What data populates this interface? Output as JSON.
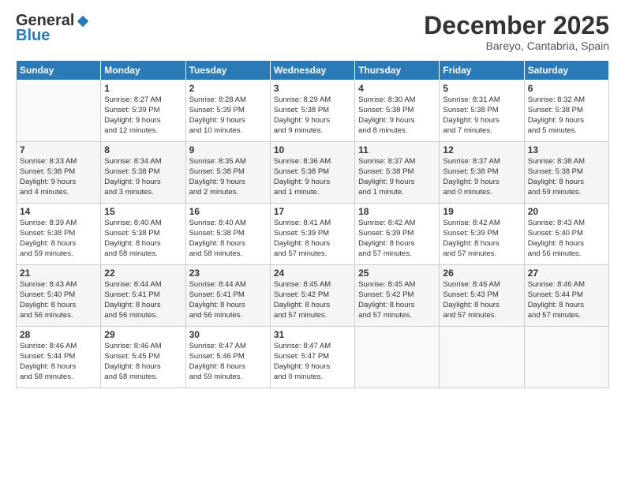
{
  "header": {
    "logo_general": "General",
    "logo_blue": "Blue",
    "month": "December 2025",
    "location": "Bareyo, Cantabria, Spain"
  },
  "weekdays": [
    "Sunday",
    "Monday",
    "Tuesday",
    "Wednesday",
    "Thursday",
    "Friday",
    "Saturday"
  ],
  "weeks": [
    [
      {
        "day": "",
        "info": ""
      },
      {
        "day": "1",
        "info": "Sunrise: 8:27 AM\nSunset: 5:39 PM\nDaylight: 9 hours\nand 12 minutes."
      },
      {
        "day": "2",
        "info": "Sunrise: 8:28 AM\nSunset: 5:39 PM\nDaylight: 9 hours\nand 10 minutes."
      },
      {
        "day": "3",
        "info": "Sunrise: 8:29 AM\nSunset: 5:38 PM\nDaylight: 9 hours\nand 9 minutes."
      },
      {
        "day": "4",
        "info": "Sunrise: 8:30 AM\nSunset: 5:38 PM\nDaylight: 9 hours\nand 8 minutes."
      },
      {
        "day": "5",
        "info": "Sunrise: 8:31 AM\nSunset: 5:38 PM\nDaylight: 9 hours\nand 7 minutes."
      },
      {
        "day": "6",
        "info": "Sunrise: 8:32 AM\nSunset: 5:38 PM\nDaylight: 9 hours\nand 5 minutes."
      }
    ],
    [
      {
        "day": "7",
        "info": "Sunrise: 8:33 AM\nSunset: 5:38 PM\nDaylight: 9 hours\nand 4 minutes."
      },
      {
        "day": "8",
        "info": "Sunrise: 8:34 AM\nSunset: 5:38 PM\nDaylight: 9 hours\nand 3 minutes."
      },
      {
        "day": "9",
        "info": "Sunrise: 8:35 AM\nSunset: 5:38 PM\nDaylight: 9 hours\nand 2 minutes."
      },
      {
        "day": "10",
        "info": "Sunrise: 8:36 AM\nSunset: 5:38 PM\nDaylight: 9 hours\nand 1 minute."
      },
      {
        "day": "11",
        "info": "Sunrise: 8:37 AM\nSunset: 5:38 PM\nDaylight: 9 hours\nand 1 minute."
      },
      {
        "day": "12",
        "info": "Sunrise: 8:37 AM\nSunset: 5:38 PM\nDaylight: 9 hours\nand 0 minutes."
      },
      {
        "day": "13",
        "info": "Sunrise: 8:38 AM\nSunset: 5:38 PM\nDaylight: 8 hours\nand 59 minutes."
      }
    ],
    [
      {
        "day": "14",
        "info": "Sunrise: 8:39 AM\nSunset: 5:38 PM\nDaylight: 8 hours\nand 59 minutes."
      },
      {
        "day": "15",
        "info": "Sunrise: 8:40 AM\nSunset: 5:38 PM\nDaylight: 8 hours\nand 58 minutes."
      },
      {
        "day": "16",
        "info": "Sunrise: 8:40 AM\nSunset: 5:38 PM\nDaylight: 8 hours\nand 58 minutes."
      },
      {
        "day": "17",
        "info": "Sunrise: 8:41 AM\nSunset: 5:39 PM\nDaylight: 8 hours\nand 57 minutes."
      },
      {
        "day": "18",
        "info": "Sunrise: 8:42 AM\nSunset: 5:39 PM\nDaylight: 8 hours\nand 57 minutes."
      },
      {
        "day": "19",
        "info": "Sunrise: 8:42 AM\nSunset: 5:39 PM\nDaylight: 8 hours\nand 57 minutes."
      },
      {
        "day": "20",
        "info": "Sunrise: 8:43 AM\nSunset: 5:40 PM\nDaylight: 8 hours\nand 56 minutes."
      }
    ],
    [
      {
        "day": "21",
        "info": "Sunrise: 8:43 AM\nSunset: 5:40 PM\nDaylight: 8 hours\nand 56 minutes."
      },
      {
        "day": "22",
        "info": "Sunrise: 8:44 AM\nSunset: 5:41 PM\nDaylight: 8 hours\nand 56 minutes."
      },
      {
        "day": "23",
        "info": "Sunrise: 8:44 AM\nSunset: 5:41 PM\nDaylight: 8 hours\nand 56 minutes."
      },
      {
        "day": "24",
        "info": "Sunrise: 8:45 AM\nSunset: 5:42 PM\nDaylight: 8 hours\nand 57 minutes."
      },
      {
        "day": "25",
        "info": "Sunrise: 8:45 AM\nSunset: 5:42 PM\nDaylight: 8 hours\nand 57 minutes."
      },
      {
        "day": "26",
        "info": "Sunrise: 8:46 AM\nSunset: 5:43 PM\nDaylight: 8 hours\nand 57 minutes."
      },
      {
        "day": "27",
        "info": "Sunrise: 8:46 AM\nSunset: 5:44 PM\nDaylight: 8 hours\nand 57 minutes."
      }
    ],
    [
      {
        "day": "28",
        "info": "Sunrise: 8:46 AM\nSunset: 5:44 PM\nDaylight: 8 hours\nand 58 minutes."
      },
      {
        "day": "29",
        "info": "Sunrise: 8:46 AM\nSunset: 5:45 PM\nDaylight: 8 hours\nand 58 minutes."
      },
      {
        "day": "30",
        "info": "Sunrise: 8:47 AM\nSunset: 5:46 PM\nDaylight: 8 hours\nand 59 minutes."
      },
      {
        "day": "31",
        "info": "Sunrise: 8:47 AM\nSunset: 5:47 PM\nDaylight: 9 hours\nand 0 minutes."
      },
      {
        "day": "",
        "info": ""
      },
      {
        "day": "",
        "info": ""
      },
      {
        "day": "",
        "info": ""
      }
    ]
  ]
}
